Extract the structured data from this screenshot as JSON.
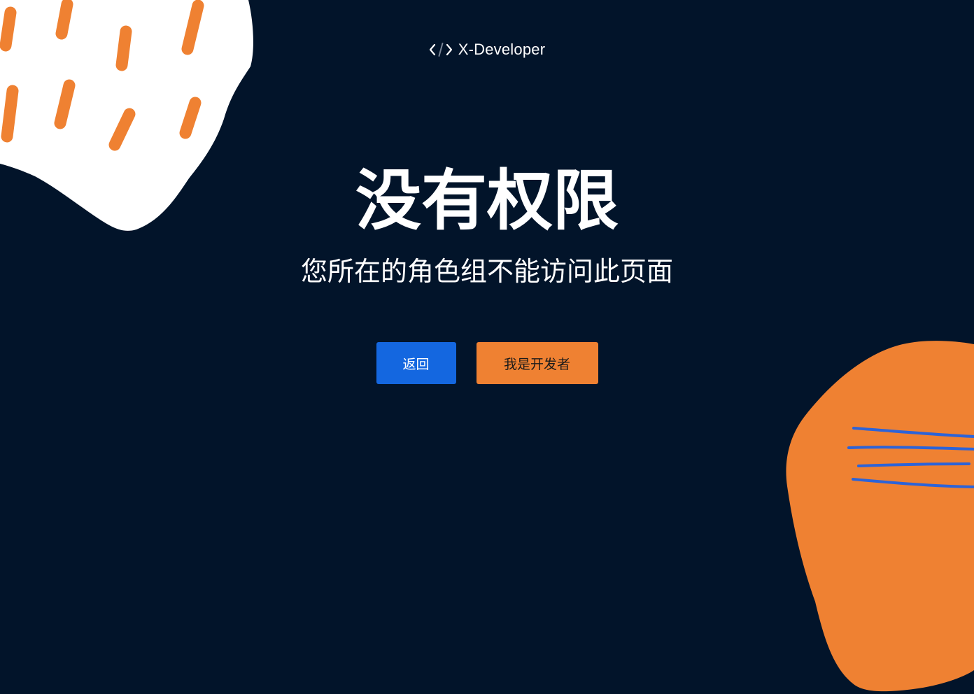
{
  "brand": {
    "name": "X-Developer",
    "icon": "code-brackets-icon"
  },
  "error": {
    "title": "没有权限",
    "message": "您所在的角色组不能访问此页面"
  },
  "actions": {
    "back_label": "返回",
    "developer_label": "我是开发者"
  },
  "colors": {
    "background": "#02142a",
    "primary": "#1467e0",
    "accent": "#ef8132",
    "text": "#ffffff"
  }
}
